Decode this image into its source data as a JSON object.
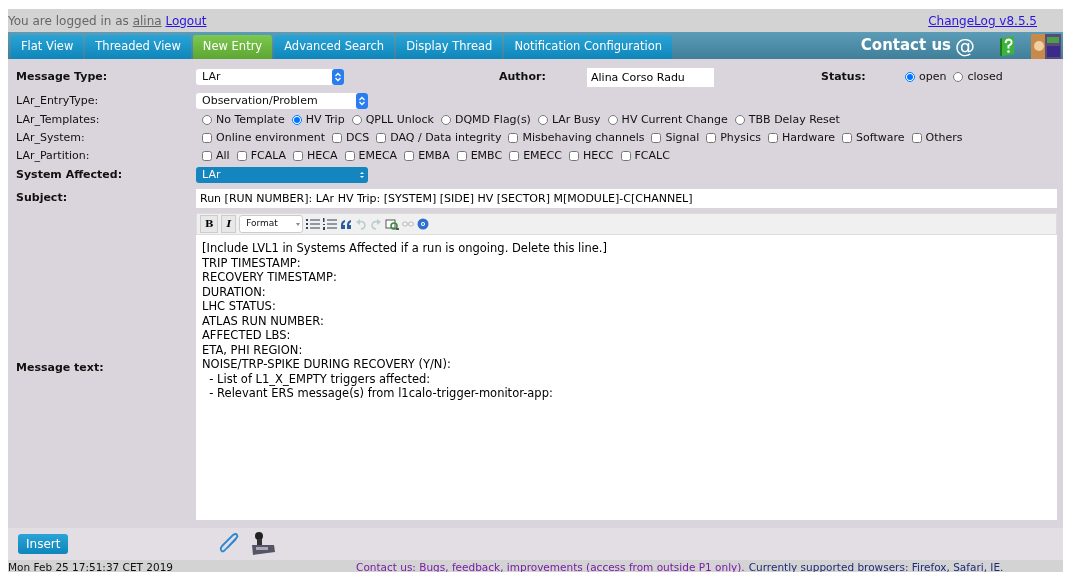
{
  "header": {
    "login_text": "You are logged in as",
    "user": "alina",
    "logout": "Logout",
    "changelog": "ChangeLog v8.5.5"
  },
  "tabs": [
    {
      "label": "Flat View",
      "selected": false
    },
    {
      "label": "Threaded View",
      "selected": false
    },
    {
      "label": "New Entry",
      "selected": true
    },
    {
      "label": "Advanced Search",
      "selected": false
    },
    {
      "label": "Display Thread",
      "selected": false
    },
    {
      "label": "Notification Configuration",
      "selected": false
    }
  ],
  "contact": {
    "label": "Contact us",
    "at": "@"
  },
  "form": {
    "message_type": {
      "label": "Message Type:",
      "value": "LAr"
    },
    "author": {
      "label": "Author:",
      "value": "Alina Corso Radu"
    },
    "status": {
      "label": "Status:",
      "options": [
        {
          "label": "open",
          "selected": true
        },
        {
          "label": "closed",
          "selected": false
        }
      ]
    },
    "entry_type": {
      "label": "LAr_EntryType:",
      "value": "Observation/Problem"
    },
    "templates": {
      "label": "LAr_Templates:",
      "options": [
        {
          "label": "No Template",
          "selected": false
        },
        {
          "label": "HV Trip",
          "selected": true
        },
        {
          "label": "QPLL Unlock",
          "selected": false
        },
        {
          "label": "DQMD Flag(s)",
          "selected": false
        },
        {
          "label": "LAr Busy",
          "selected": false
        },
        {
          "label": "HV Current Change",
          "selected": false
        },
        {
          "label": "TBB Delay Reset",
          "selected": false
        }
      ]
    },
    "system": {
      "label": "LAr_System:",
      "options": [
        {
          "label": "Online environment",
          "checked": false
        },
        {
          "label": "DCS",
          "checked": false
        },
        {
          "label": "DAQ / Data integrity",
          "checked": false
        },
        {
          "label": "Misbehaving channels",
          "checked": false
        },
        {
          "label": "Signal",
          "checked": false
        },
        {
          "label": "Physics",
          "checked": false
        },
        {
          "label": "Hardware",
          "checked": false
        },
        {
          "label": "Software",
          "checked": false
        },
        {
          "label": "Others",
          "checked": false
        }
      ]
    },
    "partition": {
      "label": "LAr_Partition:",
      "options": [
        {
          "label": "All",
          "checked": false
        },
        {
          "label": "FCALA",
          "checked": false
        },
        {
          "label": "HECA",
          "checked": false
        },
        {
          "label": "EMECA",
          "checked": false
        },
        {
          "label": "EMBA",
          "checked": false
        },
        {
          "label": "EMBC",
          "checked": false
        },
        {
          "label": "EMECC",
          "checked": false
        },
        {
          "label": "HECC",
          "checked": false
        },
        {
          "label": "FCALC",
          "checked": false
        }
      ]
    },
    "system_affected": {
      "label": "System Affected:",
      "value": "LAr"
    },
    "subject": {
      "label": "Subject:",
      "value": "Run [RUN NUMBER]: LAr HV Trip: [SYSTEM] [SIDE] HV [SECTOR] M[MODULE]-C[CHANNEL]"
    },
    "editor_toolbar": {
      "bold": "B",
      "italic": "I",
      "format": "Format"
    },
    "message": {
      "label": "Message text:",
      "lines": [
        "[Include LVL1 in Systems Affected if a run is ongoing. Delete this line.]",
        "TRIP TIMESTAMP:",
        "RECOVERY TIMESTAMP:",
        "DURATION:",
        "LHC STATUS:",
        "ATLAS RUN NUMBER:",
        "AFFECTED LBS:",
        "ETA, PHI REGION:",
        "NOISE/TRP-SPIKE DURING RECOVERY (Y/N):",
        "  - List of L1_X_EMPTY triggers affected:",
        "  - Relevant ERS message(s) from l1calo-trigger-monitor-app:"
      ]
    }
  },
  "insert": "Insert",
  "footer": {
    "timestamp": "Mon Feb 25 17:51:37 CET 2019",
    "contact_link": "Contact us: Bugs, feedback, improvements (access from outside P1 only).",
    "browsers": "Currently supported browsers: Firefox, Safari, IE."
  }
}
